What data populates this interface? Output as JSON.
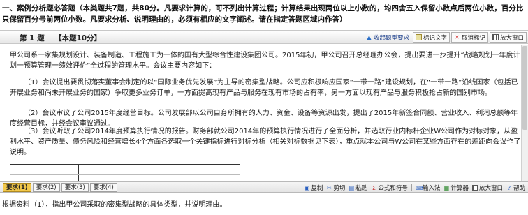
{
  "instructions": "一、案例分析题必答题（本类题共7题，共80分。凡要求计算的，可不列出计算过程；计算结果出现两位以上小数的，均四舍五入保留小数点后两位小数，百分比只保留百分号前两位小数。凡要求分析、说明理由的，必须有相应的文字阐述。请在指定答题区域内作答）",
  "question": {
    "number": "第 1 题",
    "score": "【本题10分】",
    "tools": {
      "view_answer": "收起题型要求",
      "mark": "标记文字",
      "unmark": "取消标记",
      "enlarge": "放大窗口"
    },
    "paragraphs": [
      "甲公司系一家集规划设计、装备制造、工程施工为一体的国有大型综合性建设集团公司。2015年初，甲公司召开总经理办公会，提出要进一步提升“战略规划一年度计划一预算管理一绩效评价”全过程的管理水平。会议主要内容如下：",
      "（1）会议提出要贯彻落实董事会制定的以“国际业务优先发展”为主导的密集型战略。公司应积极响应国家“一带一路”建设规划，在“一带一路”沿线国家（包括已开展业务和尚未开展业务的国家）争取更多业务订单，一方面提高现有产品与服务在现有市场的占有率，另一方面以现有产品与服务积极抢占新的国别市场。",
      "（2）会议审议了公司2015年度经营目标。公司发展部以公司自身所拥有的人力、资金、设备等资源出发，提出了2015年新签合同额、营业收入、利润总额等年度经营目标，并经会议审议通过。",
      "（3）会议听取了公司2014年度预算执行情况的报告。财务部就公司2014年的预算执行情况进行了全面分析，并选取行业内标杆企业W公司作为对标对象，从盈利水平、资产质量、债务风险和经营增长4个方面各选取一个关键指标进行对标分析（相关对标数据见下表），重点就本公司与W公司在某些方面存在的差距向会议作了说明。"
    ]
  },
  "answer_bar": {
    "tabs": [
      "要求(1)",
      "要求(2)",
      "要求(3)",
      "要求(4)"
    ],
    "active_tab": 0,
    "tools": [
      "复制",
      "剪切",
      "粘贴",
      "公式和符号",
      "输入法",
      "计算器",
      "放大窗口",
      "帮助"
    ]
  },
  "prompt": "根据资料（1），指出甲公司采取的密集型战略的具体类型，并说明理由。",
  "colors": {
    "active_tab": "#f2c84a",
    "header_bg": "#e6e6e6"
  }
}
